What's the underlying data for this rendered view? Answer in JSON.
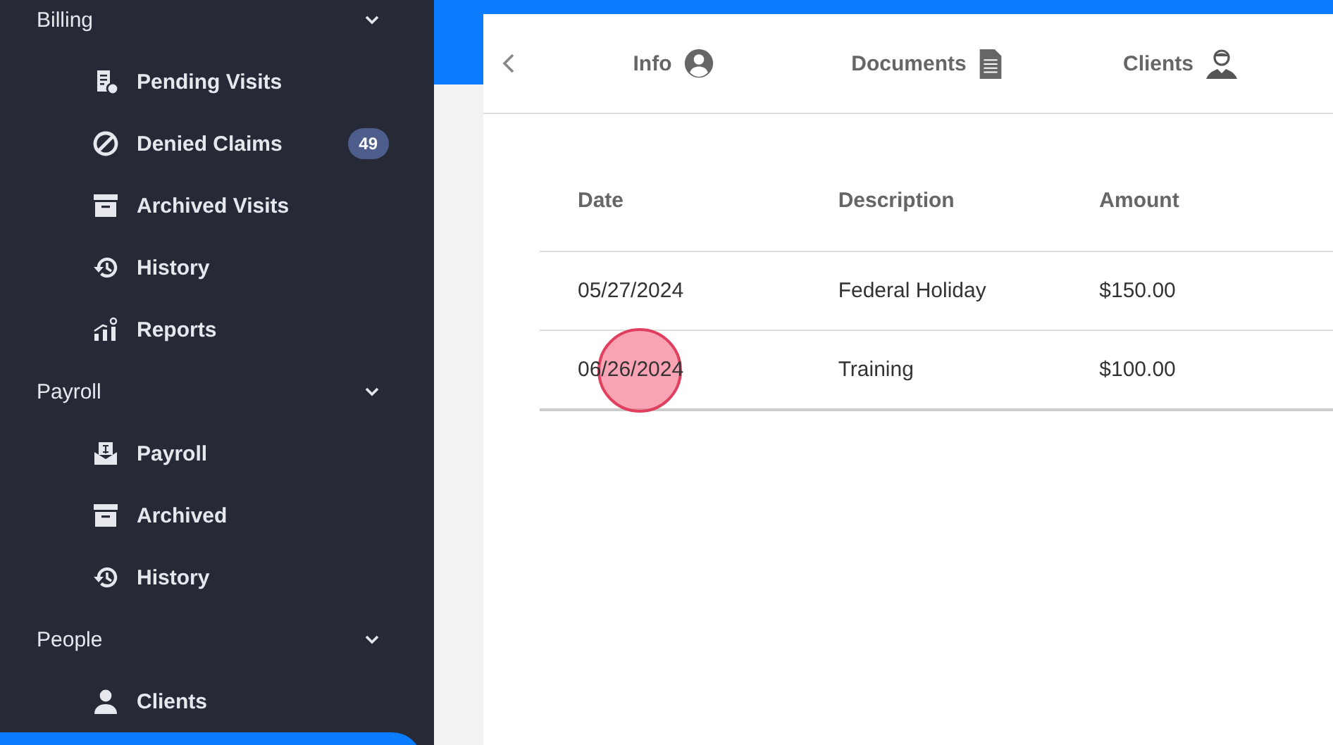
{
  "sidebar": {
    "groups": [
      {
        "label": "Billing",
        "expanded": true,
        "items": [
          {
            "label": "Pending Visits"
          },
          {
            "label": "Denied Claims",
            "badge": "49"
          },
          {
            "label": "Archived Visits"
          },
          {
            "label": "History"
          },
          {
            "label": "Reports"
          }
        ]
      },
      {
        "label": "Payroll",
        "expanded": true,
        "items": [
          {
            "label": "Payroll"
          },
          {
            "label": "Archived"
          },
          {
            "label": "History"
          }
        ]
      },
      {
        "label": "People",
        "expanded": true,
        "items": [
          {
            "label": "Clients"
          }
        ]
      }
    ]
  },
  "tabs": [
    {
      "label": "Info"
    },
    {
      "label": "Documents"
    },
    {
      "label": "Clients"
    }
  ],
  "table": {
    "columns": [
      "Date",
      "Description",
      "Amount"
    ],
    "rows": [
      [
        "05/27/2024",
        "Federal Holiday",
        "$150.00"
      ],
      [
        "06/26/2024",
        "Training",
        "$100.00"
      ]
    ]
  }
}
